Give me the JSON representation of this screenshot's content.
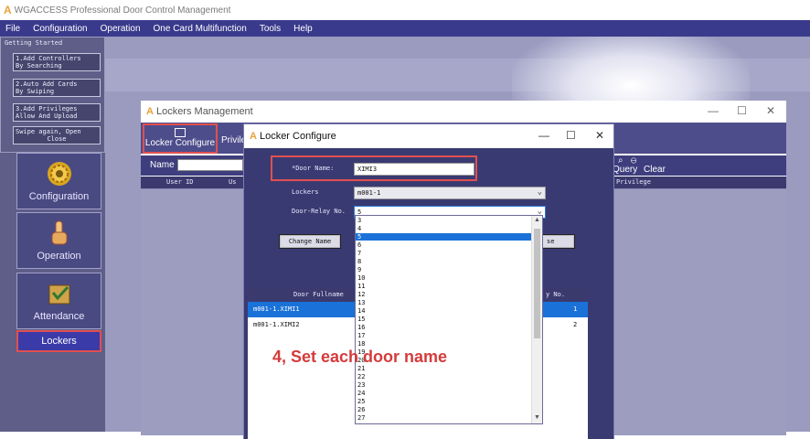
{
  "app": {
    "title": "WGACCESS Professional Door Control Management",
    "logo_glyph": "A"
  },
  "menu": [
    "File",
    "Configuration",
    "Operation",
    "One Card Multifunction",
    "Tools",
    "Help"
  ],
  "getting_started": {
    "legend": "Getting Started",
    "buttons": [
      {
        "line1": "1.Add Controllers",
        "line2": "By Searching"
      },
      {
        "line1": "2.Auto Add Cards",
        "line2": "By Swiping"
      },
      {
        "line1": "3.Add Privileges",
        "line2": "Allow And Upload"
      },
      {
        "line1": "Swipe again, Open",
        "line2": "Close"
      }
    ]
  },
  "nav": {
    "configuration": "Configuration",
    "operation": "Operation",
    "attendance": "Attendance",
    "lockers": "Lockers"
  },
  "lockers_window": {
    "title": "Lockers Management",
    "toolbar": {
      "locker_configure": "Locker Configure",
      "privilege": "Privile"
    },
    "search": {
      "name_label": "Name",
      "query": "Query",
      "clear": "Clear"
    },
    "grid_headers": {
      "user_id": "User ID",
      "col2": "Us",
      "privilege": "Privilege"
    }
  },
  "locker_configure": {
    "title": "Locker Configure",
    "door_name_label": "*Door Name:",
    "door_name_value": "XIMI3",
    "lockers_label": "Lockers",
    "lockers_value": "m001-1",
    "door_relay_label": "Door-Relay No.",
    "door_relay_value": "5",
    "change_name_button": "Change Name",
    "close_button_fragment": "se",
    "table": {
      "col_fullname": "Door Fullname",
      "col_relay": "y No.",
      "rows": [
        {
          "fullname": "m001-1.XIMI1",
          "relay": "1"
        },
        {
          "fullname": "m001-1.XIMI2",
          "relay": "2"
        }
      ]
    }
  },
  "relay_options": [
    "3",
    "4",
    "5",
    "6",
    "7",
    "8",
    "9",
    "10",
    "11",
    "12",
    "13",
    "14",
    "15",
    "16",
    "17",
    "18",
    "19",
    "20",
    "21",
    "22",
    "23",
    "24",
    "25",
    "26",
    "27"
  ],
  "selected_option": "5",
  "annotation": "4, Set each door name",
  "colors": {
    "menu_bg": "#3a3a8c",
    "panel_bg": "#5e5e88",
    "workspace_bg": "#9a9bbf",
    "highlight_red": "#e05050",
    "selection_blue": "#1a72d8",
    "annotation_red": "#d43b3b"
  }
}
